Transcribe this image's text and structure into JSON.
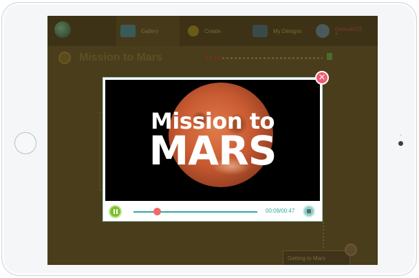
{
  "nav": {
    "items": [
      {
        "label": "Gallery",
        "icon": "gallery-icon"
      },
      {
        "label": "Create",
        "icon": "lightbulb-icon"
      },
      {
        "label": "My Designs",
        "icon": "designs-icon"
      }
    ],
    "user": {
      "name": "Demo4023",
      "icon": "avatar"
    }
  },
  "page": {
    "title": "Mission to Mars"
  },
  "card": {
    "label": "Getting to Mars"
  },
  "modal": {
    "video_title_line1": "Mission to",
    "video_title_line2": "MARS",
    "time": "00:09/00:47",
    "progress_fraction": 0.19,
    "close_glyph": "×"
  },
  "colors": {
    "accent": "#2aa89a",
    "play": "#7dbf2e",
    "close": "#f25c6e",
    "thumb": "#f06a6a"
  }
}
